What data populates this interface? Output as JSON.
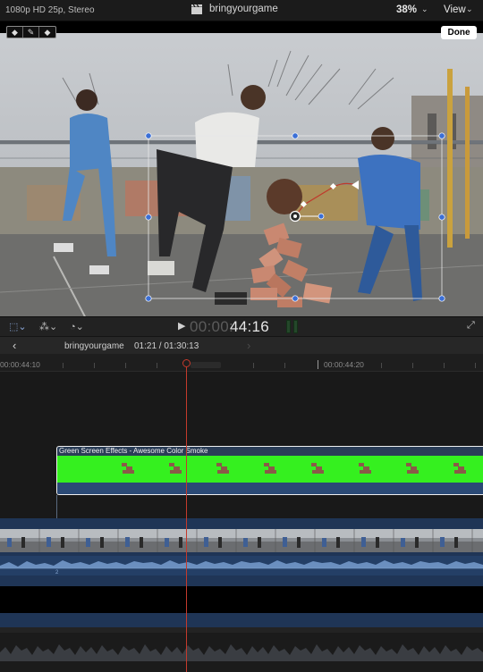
{
  "topbar": {
    "format": "1080p HD 25p, Stereo",
    "project": "bringyourgame",
    "zoom": "38%",
    "view": "View",
    "chevron": "⌄"
  },
  "viewer": {
    "done_label": "Done",
    "ctl_icons": [
      "arrow-left-icon",
      "pen-tool-icon",
      "arrow-right-icon"
    ]
  },
  "toolbar": {
    "timecode_dim": "00:00:",
    "timecode_lit": "44:16",
    "play": "▶"
  },
  "nav": {
    "name": "bringyourgame",
    "duration": "01:21 / 01:30:13",
    "back": "‹",
    "forward": "›"
  },
  "ruler": {
    "left_label": "00:00:44:10",
    "right_label": "00:00:44:20"
  },
  "timeline": {
    "clip_title": "Green Screen Effects - Awesome Color Smoke",
    "clip_color": "#35f01f",
    "track_color": "#1f3556",
    "playhead_color": "#c43a2c",
    "lane_marker": "2"
  }
}
